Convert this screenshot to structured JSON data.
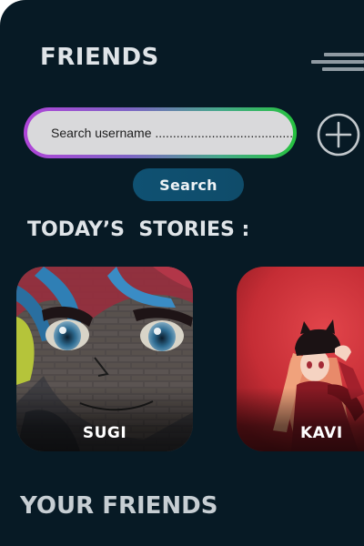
{
  "header": {
    "title": "FRIENDS",
    "menu_icon": "hamburger-menu-icon"
  },
  "search": {
    "placeholder": "Search username .............................................",
    "button_label": "Search",
    "add_icon": "plus-circle-icon"
  },
  "stories": {
    "heading": "TODAY’S  STORIES :",
    "items": [
      {
        "name": "SUGI",
        "image": "graffiti anime face on brick wall"
      },
      {
        "name": "KAVI",
        "image": "anime girl with cat-ear cap on red background"
      }
    ]
  },
  "friends": {
    "heading": "YOUR FRIENDS"
  },
  "colors": {
    "background": "#071a25",
    "search_field": "#d9d9db",
    "search_border_start": "#b044d8",
    "search_border_end": "#26c23f",
    "search_button": "#0f4c6a",
    "heading_text": "#dfe4e8"
  }
}
